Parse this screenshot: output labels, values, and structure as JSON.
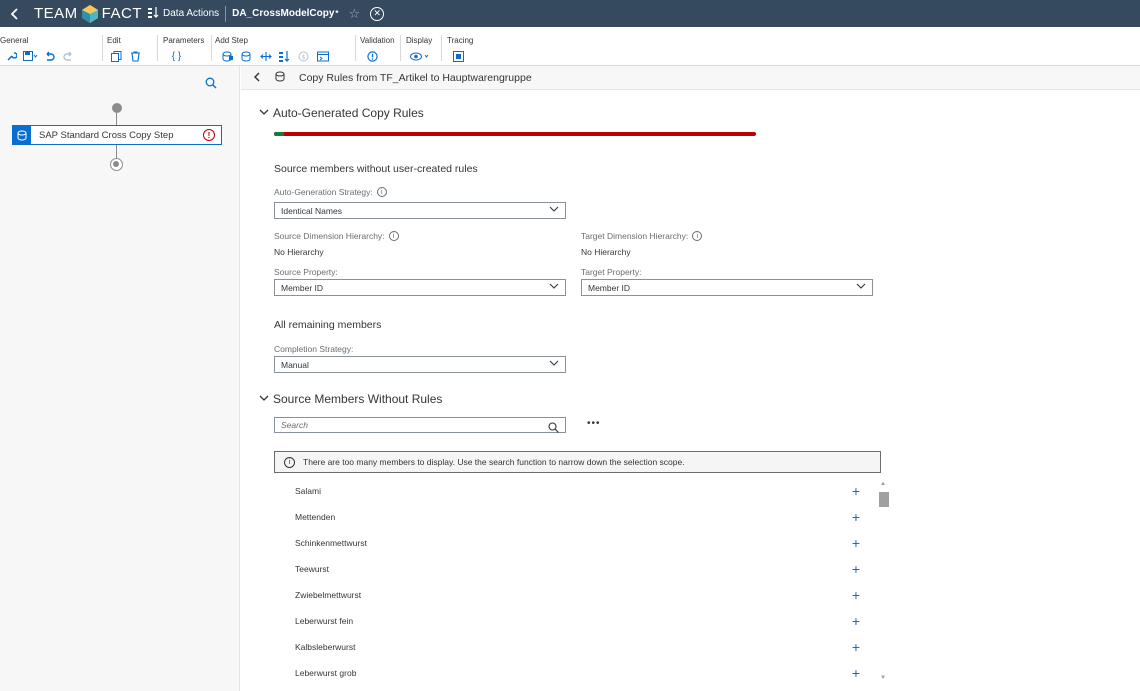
{
  "shellbar": {
    "back_icon": "back-icon",
    "logo_left": "TEAM",
    "logo_right": "FACT",
    "data_actions_label": "Data Actions",
    "file_title": "DA_CrossModelCopy",
    "modified_marker": "*",
    "favorite_icon": "star-icon",
    "close_icon": "close-icon"
  },
  "toolbar": {
    "groups": [
      {
        "label": "General"
      },
      {
        "label": "Edit"
      },
      {
        "label": "Parameters"
      },
      {
        "label": "Add Step"
      },
      {
        "label": "Validation"
      },
      {
        "label": "Display"
      },
      {
        "label": "Tracing"
      }
    ]
  },
  "left": {
    "step_label": "SAP Standard Cross Copy Step"
  },
  "header": {
    "title": "Copy Rules from TF_Artikel to Hauptwarengruppe"
  },
  "auto_rules": {
    "title": "Auto-Generated Copy Rules",
    "progress_success_fraction": 0.02,
    "colors": {
      "success": "#107e3e",
      "error": "#bb0000"
    },
    "source_members_heading": "Source members without user-created rules",
    "strategy_label": "Auto-Generation Strategy:",
    "strategy_value": "Identical Names",
    "source_hierarchy_label": "Source Dimension Hierarchy:",
    "source_hierarchy_value": "No Hierarchy",
    "target_hierarchy_label": "Target Dimension Hierarchy:",
    "target_hierarchy_value": "No Hierarchy",
    "source_property_label": "Source Property:",
    "source_property_value": "Member ID",
    "target_property_label": "Target Property:",
    "target_property_value": "Member ID",
    "remaining_heading": "All remaining members",
    "completion_label": "Completion Strategy:",
    "completion_value": "Manual"
  },
  "members": {
    "title": "Source Members Without Rules",
    "search_placeholder": "Search",
    "more_label": "•••",
    "info_message": "There are too many members to display. Use the search function to narrow down the selection scope.",
    "items": [
      "Salami",
      "Mettenden",
      "Schinkenmettwurst",
      "Teewurst",
      "Zwiebelmettwurst",
      "Leberwurst fein",
      "Kalbsleberwurst",
      "Leberwurst grob"
    ]
  }
}
